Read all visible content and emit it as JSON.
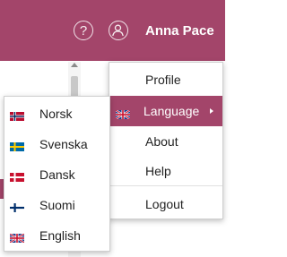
{
  "header": {
    "username": "Anna Pace",
    "help_icon": "help-icon",
    "user_icon": "user-icon",
    "accent_color": "#a3456a"
  },
  "user_menu": {
    "items": [
      {
        "label": "Profile"
      },
      {
        "label": "Language",
        "flag": "uk-flag",
        "active": true
      },
      {
        "label": "About"
      },
      {
        "label": "Help"
      },
      {
        "label": "Logout"
      }
    ]
  },
  "language_menu": {
    "items": [
      {
        "label": "Norsk",
        "flag": "norway-flag"
      },
      {
        "label": "Svenska",
        "flag": "sweden-flag"
      },
      {
        "label": "Dansk",
        "flag": "denmark-flag"
      },
      {
        "label": "Suomi",
        "flag": "finland-flag"
      },
      {
        "label": "English",
        "flag": "uk-flag"
      }
    ]
  }
}
